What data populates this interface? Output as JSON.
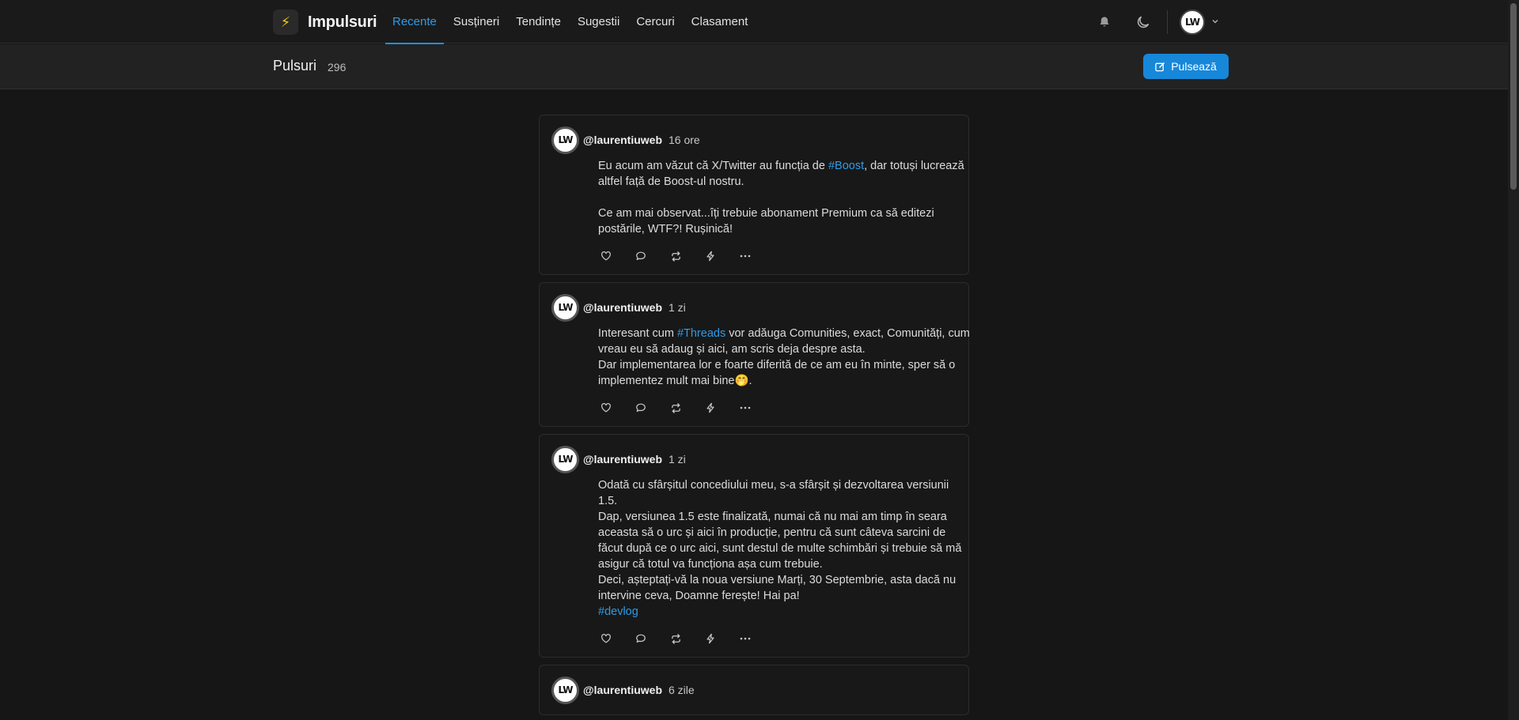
{
  "app": {
    "name": "Impulsuri",
    "logo_icon": "⚡"
  },
  "nav": {
    "items": [
      {
        "label": "Recente",
        "active": true
      },
      {
        "label": "Susțineri",
        "active": false
      },
      {
        "label": "Tendințe",
        "active": false
      },
      {
        "label": "Sugestii",
        "active": false
      },
      {
        "label": "Cercuri",
        "active": false
      },
      {
        "label": "Clasament",
        "active": false
      }
    ]
  },
  "user_menu": {
    "avatar_text": "LW"
  },
  "subheader": {
    "title": "Pulsuri",
    "count": "296",
    "post_button": "Pulsează"
  },
  "colors": {
    "accent": "#1787d9",
    "link": "#2f9be6",
    "background": "#161616"
  },
  "posts": [
    {
      "avatar_text": "LW",
      "handle": "@laurentiuweb",
      "time": "16 ore",
      "segments": [
        {
          "t": "Eu acum am văzut că X/Twitter au funcția de "
        },
        {
          "t": "#Boost",
          "tag": true
        },
        {
          "t": ", dar totuși lucrează altfel față de Boost-ul nostru.\n\nCe am mai observat...îți trebuie abonament Premium ca să editezi postările, WTF?! Rușinică!"
        }
      ]
    },
    {
      "avatar_text": "LW",
      "handle": "@laurentiuweb",
      "time": "1 zi",
      "segments": [
        {
          "t": "Interesant cum "
        },
        {
          "t": "#Threads",
          "tag": true
        },
        {
          "t": " vor adăuga Comunities, exact, Comunități, cum vreau eu să adaug și aici, am scris deja despre asta.\nDar implementarea lor e foarte diferită de ce am eu în minte, sper să o implementez mult mai bine🤭."
        }
      ]
    },
    {
      "avatar_text": "LW",
      "handle": "@laurentiuweb",
      "time": "1 zi",
      "segments": [
        {
          "t": "Odată cu sfârșitul concediului meu, s-a sfârșit și dezvoltarea versiunii 1.5.\nDap, versiunea 1.5 este finalizată, numai că nu mai am timp în seara aceasta să o urc și aici în producție, pentru că sunt câteva sarcini de făcut după ce o urc aici, sunt destul de multe schimbări și trebuie să mă asigur că totul va funcționa așa cum trebuie.\nDeci, așteptați-vă la noua versiune Marți, 30 Septembrie, asta dacă nu intervine ceva, Doamne ferește! Hai pa!\n"
        },
        {
          "t": "#devlog",
          "tag": true
        }
      ]
    },
    {
      "avatar_text": "LW",
      "handle": "@laurentiuweb",
      "time": "6 zile",
      "segments": []
    }
  ]
}
